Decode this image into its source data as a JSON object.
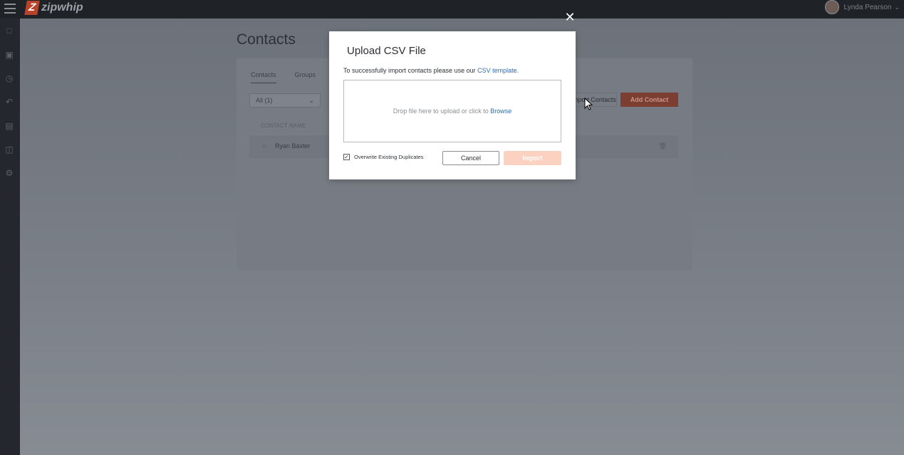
{
  "topbar": {
    "brand": "zipwhip",
    "brand_mark": "Z",
    "user_name": "Lynda Pearson"
  },
  "page": {
    "title": "Contacts",
    "tabs": [
      "Contacts",
      "Groups"
    ],
    "filter_label": "All (1)",
    "import_contacts_label": "Import Contacts",
    "add_contact_label": "Add Contact",
    "column_header": "CONTACT NAME",
    "rows": [
      {
        "name": "Ryan Baxter"
      }
    ]
  },
  "modal": {
    "title": "Upload CSV File",
    "hint_prefix": "To successfully import contacts please use our ",
    "hint_link": "CSV template.",
    "drop_prefix": "Drop file here to upload or click to ",
    "drop_link": "Browse",
    "checkbox_label": "Overwrite Existing Duplicates",
    "checkbox_checked": true,
    "cancel_label": "Cancel",
    "import_label": "Import"
  },
  "colors": {
    "accent": "#b8432a",
    "link": "#2f6eb5",
    "import_disabled": "#fbd1c1"
  }
}
